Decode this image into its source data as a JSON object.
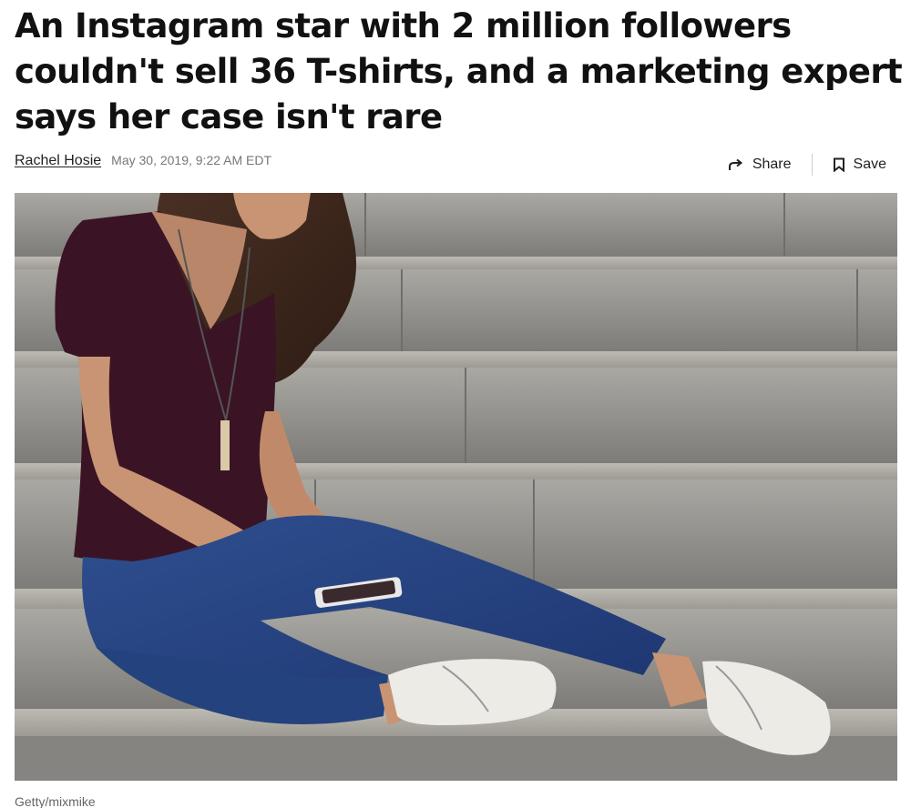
{
  "article": {
    "headline": "An Instagram star with 2 million followers couldn't sell 36 T-shirts, and a marketing expert says her case isn't rare",
    "author": "Rachel Hosie",
    "date": "May 30, 2019, 9:22 AM EDT"
  },
  "actions": {
    "share_label": "Share",
    "share_icon": "share-arrow-icon",
    "save_label": "Save",
    "save_icon": "bookmark-icon"
  },
  "image": {
    "caption": "Getty/mixmike"
  }
}
